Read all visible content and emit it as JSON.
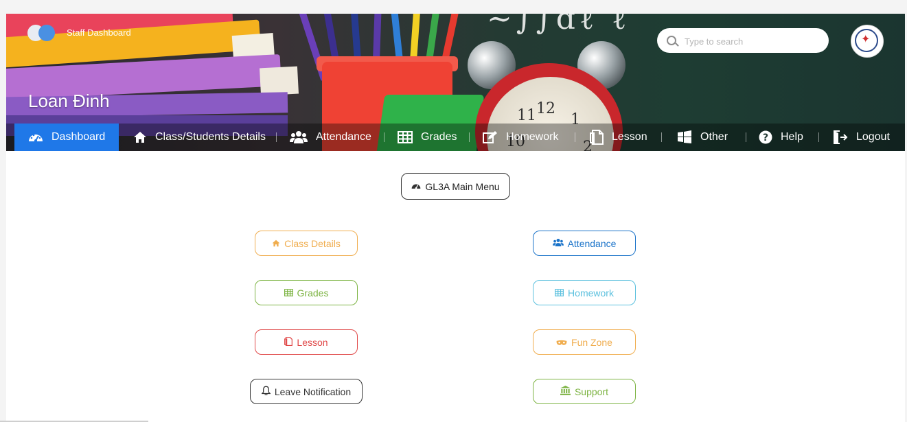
{
  "header": {
    "brand_label": "Staff Dashboard",
    "user_name": "Loan Đinh",
    "search_placeholder": "Type to search"
  },
  "nav": {
    "items": [
      {
        "label": "Dashboard",
        "icon": "dashboard-icon",
        "active": true
      },
      {
        "label": "Class/Students Details",
        "icon": "home-icon"
      },
      {
        "label": "Attendance",
        "icon": "users-icon"
      },
      {
        "label": "Grades",
        "icon": "table-icon"
      },
      {
        "label": "Homework",
        "icon": "edit-icon"
      },
      {
        "label": "Lesson",
        "icon": "file-icon"
      },
      {
        "label": "Other",
        "icon": "windows-icon"
      },
      {
        "label": "Help",
        "icon": "question-icon"
      },
      {
        "label": "Logout",
        "icon": "logout-icon"
      }
    ]
  },
  "main": {
    "menu_button": "GL3A Main Menu",
    "options": [
      {
        "label": "Class Details",
        "icon": "home-icon",
        "color": "#f0ad4e"
      },
      {
        "label": "Attendance",
        "icon": "users-icon",
        "color": "#1a73c9"
      },
      {
        "label": "Grades",
        "icon": "table-icon",
        "color": "#7cb342"
      },
      {
        "label": "Homework",
        "icon": "table-icon",
        "color": "#5bc0de"
      },
      {
        "label": "Lesson",
        "icon": "file-icon",
        "color": "#e04848"
      },
      {
        "label": "Fun Zone",
        "icon": "mask-icon",
        "color": "#f0ad4e"
      },
      {
        "label": "Leave Notification",
        "icon": "bell-icon",
        "color": "#333333"
      },
      {
        "label": "Support",
        "icon": "bank-icon",
        "color": "#7cb342"
      }
    ]
  },
  "colors": {
    "nav_active": "#1f78e8",
    "accent": "#4a90e2"
  }
}
